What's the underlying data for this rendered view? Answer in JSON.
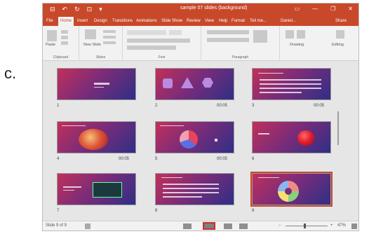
{
  "question_letter": "c.",
  "window": {
    "title": "sample 07 slides (background)"
  },
  "quick_access": [
    "⊟",
    "↶",
    "↻",
    "⊡",
    "▾"
  ],
  "window_controls": [
    "▭",
    "—",
    "❐",
    "✕"
  ],
  "tabs": [
    "File",
    "Home",
    "Insert",
    "Design",
    "Transitions",
    "Animations",
    "Slide Show",
    "Review",
    "View",
    "Help",
    "Format",
    "Tell me...",
    "Daniel...",
    "Share"
  ],
  "ribbon": {
    "groups": [
      "Clipboard",
      "Slides",
      "Font",
      "Paragraph",
      "Drawing",
      "Editing"
    ],
    "paste": "Paste",
    "new_slide": "New Slide",
    "drawing": "Drawing",
    "editing": "Editing"
  },
  "slides": [
    {
      "number": "1",
      "time": ""
    },
    {
      "number": "2",
      "time": "00:05"
    },
    {
      "number": "3",
      "time": "00:05"
    },
    {
      "number": "4",
      "time": "00:05"
    },
    {
      "number": "5",
      "time": "00:05"
    },
    {
      "number": "6",
      "time": ""
    },
    {
      "number": "7",
      "time": ""
    },
    {
      "number": "8",
      "time": ""
    },
    {
      "number": "9",
      "time": ""
    }
  ],
  "status": {
    "slide_info": "Slide 9 of 9",
    "zoom": "47%"
  },
  "colors": {
    "accent": "#c8482a",
    "highlight": "#d12a2a"
  }
}
